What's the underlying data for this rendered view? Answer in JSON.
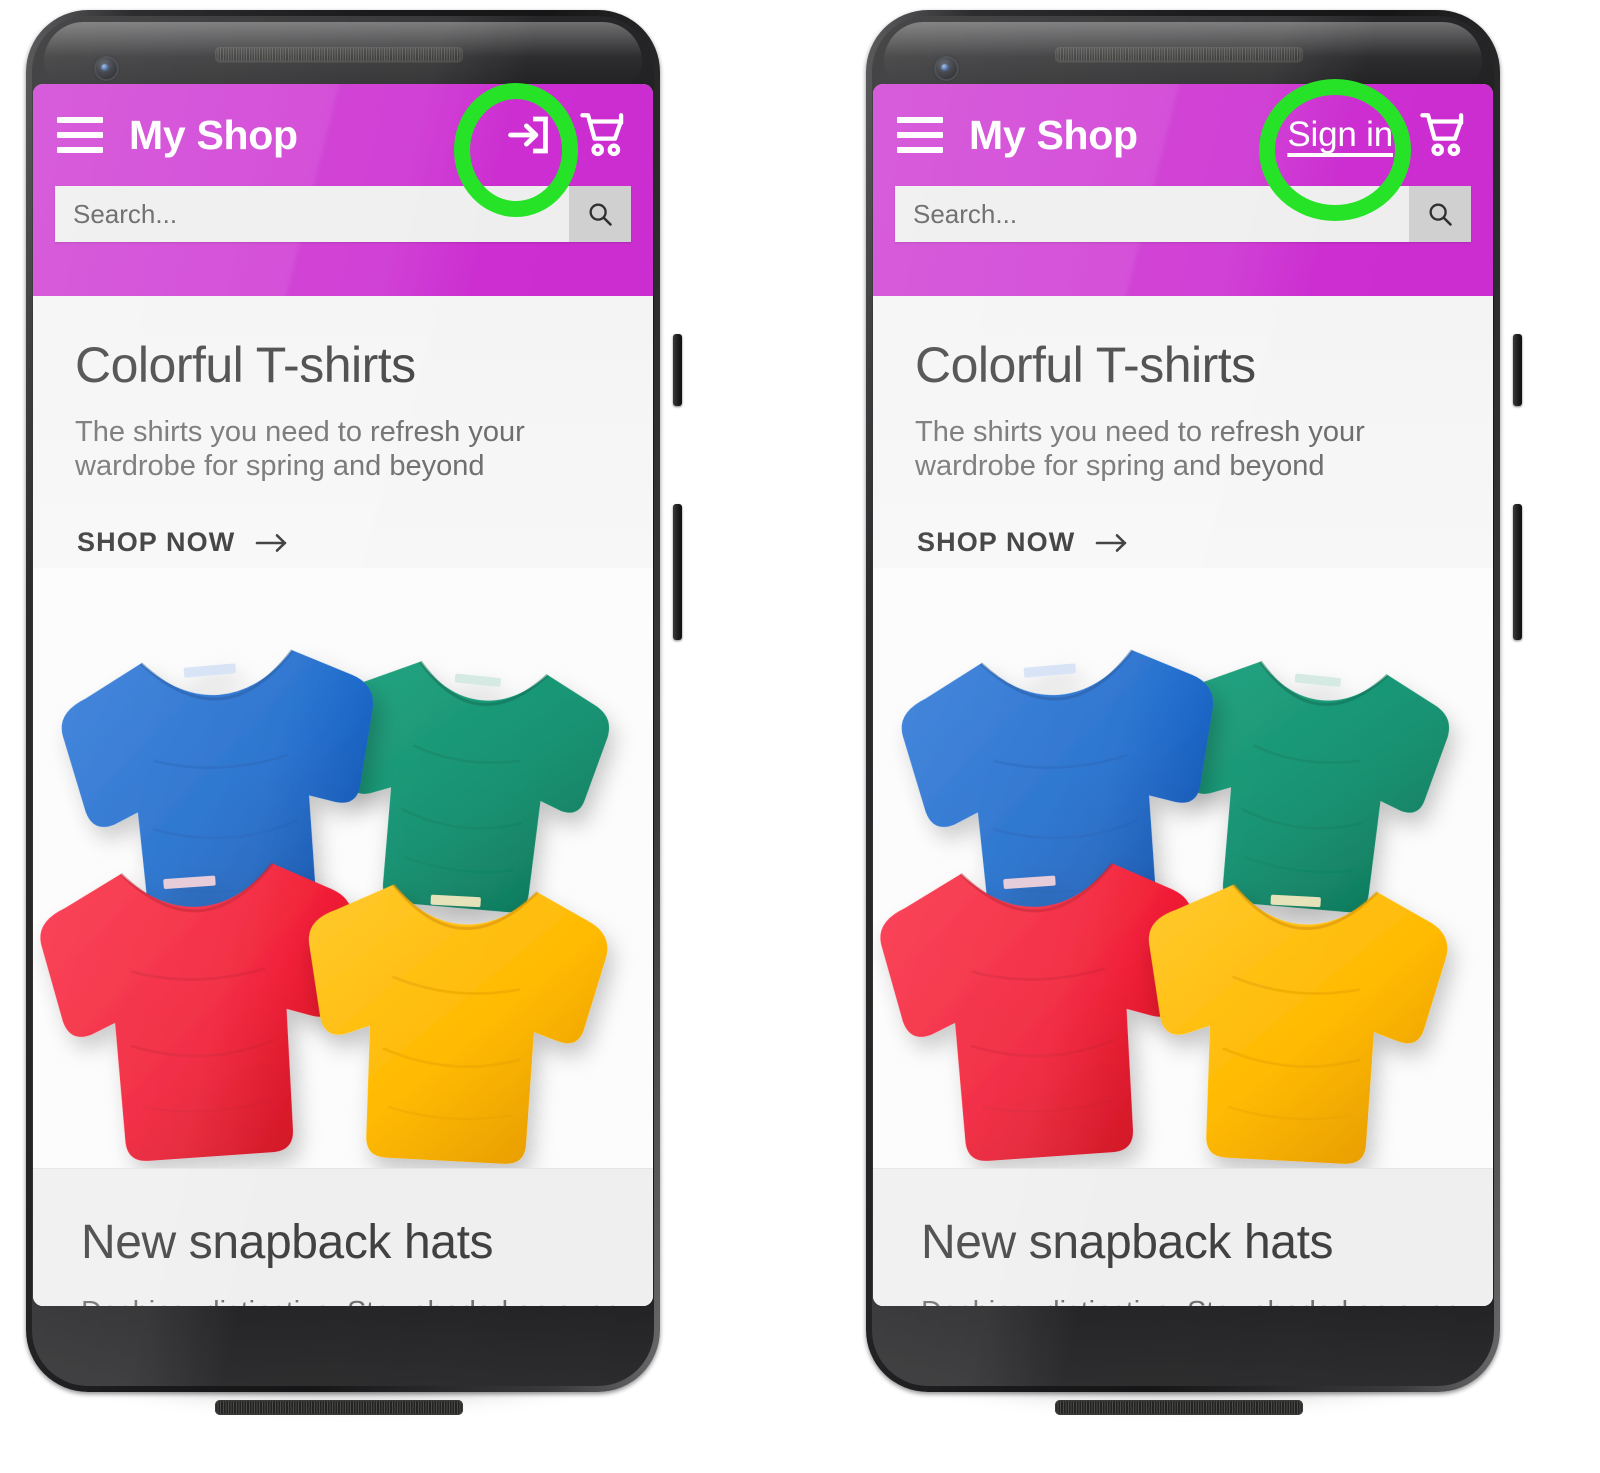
{
  "app": {
    "brand": "My Shop",
    "accent_color": "#cb2bd0",
    "highlight_color": "#27e327"
  },
  "search": {
    "placeholder": "Search...",
    "value": "",
    "button_icon": "search-icon"
  },
  "appbar": {
    "menu_icon": "hamburger-menu-icon",
    "cart_icon": "shopping-cart-icon",
    "login_icon": "login-arrow-icon",
    "signin_label": "Sign in"
  },
  "hero": {
    "title": "Colorful T-shirts",
    "subtitle": "The shirts you need to refresh your wardrobe for spring and beyond",
    "cta_label": "SHOP NOW",
    "cta_icon": "arrow-right-icon",
    "image_alt": "four-tshirts-photo",
    "shirt_colors": {
      "blue": "#1565c8",
      "green": "#159171",
      "red": "#f01830",
      "yellow": "#ffb900"
    }
  },
  "section2": {
    "title": "New snapback hats",
    "subtitle": "Dashing, distinctive. Stay shaded on sunny"
  },
  "phones": [
    {
      "id": "phone-left",
      "variant": "login-icon",
      "highlight": "login-icon-button"
    },
    {
      "id": "phone-right",
      "variant": "signin-text",
      "highlight": "sign-in-link"
    }
  ]
}
